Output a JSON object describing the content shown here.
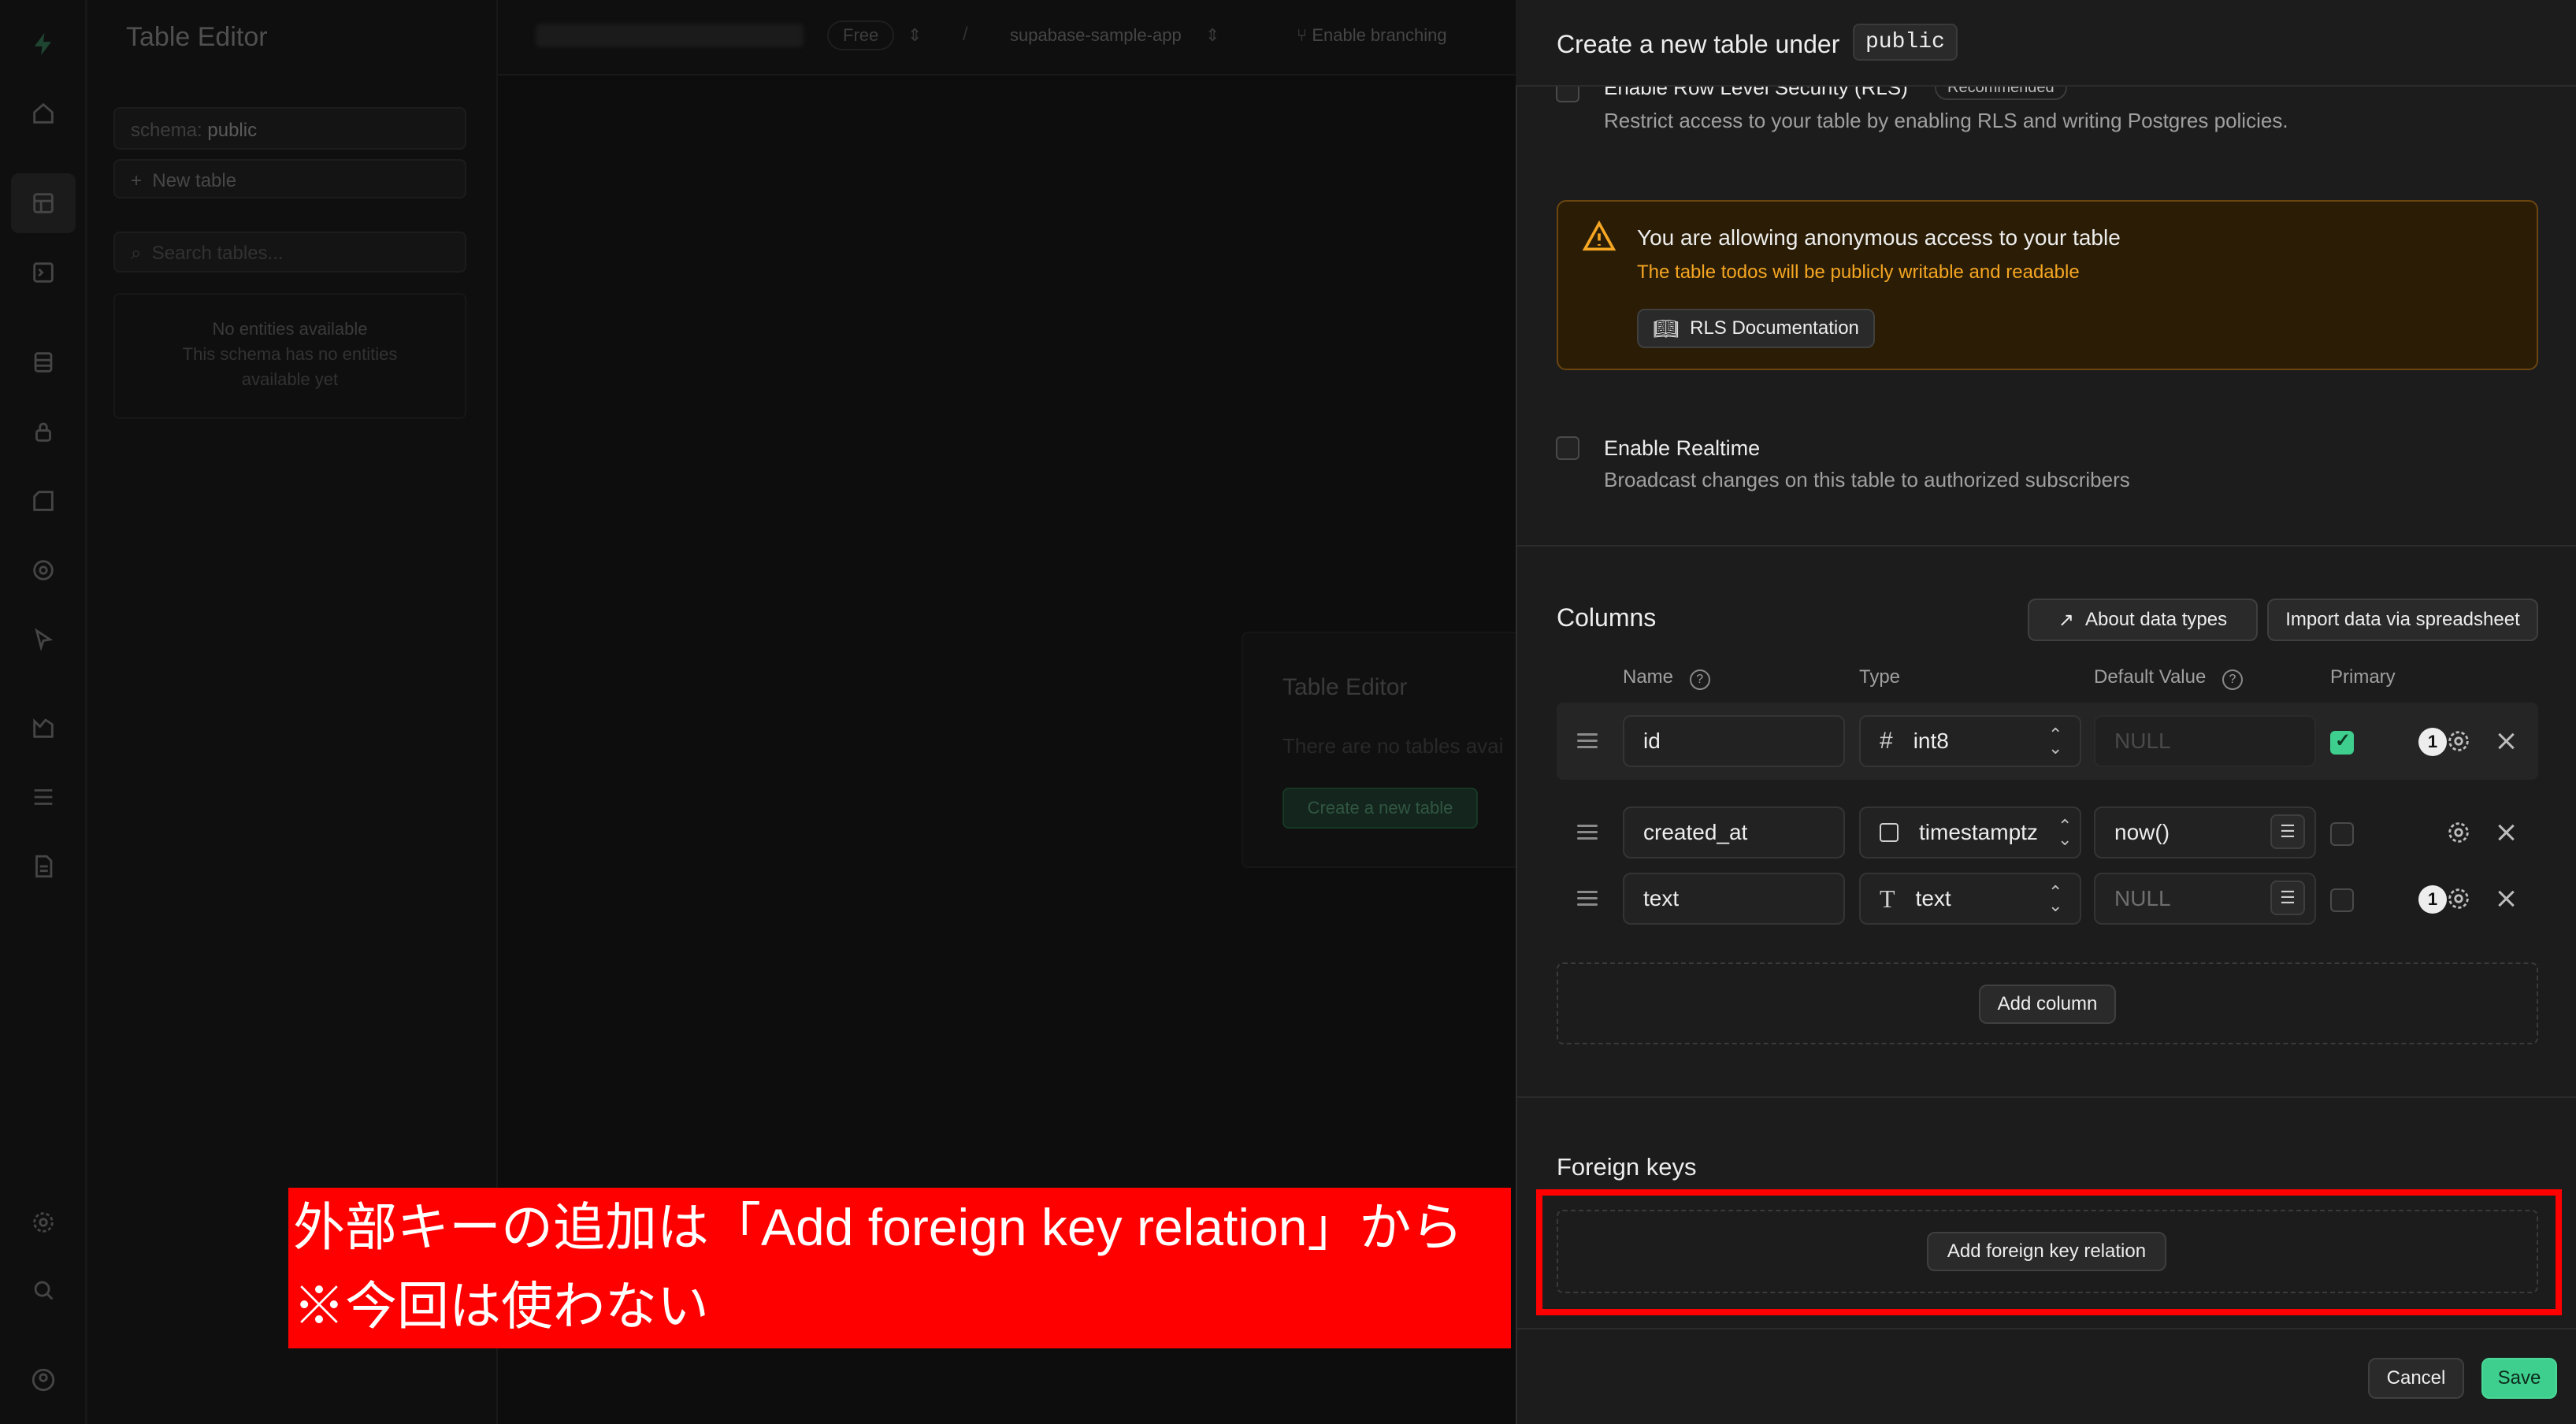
{
  "sidebar_nav": {
    "title": "Table Editor",
    "schema_label": "schema:",
    "schema_value": "public",
    "new_table": "New table",
    "search_placeholder": "Search tables...",
    "empty_title": "No entities available",
    "empty_desc_1": "This schema has no entities",
    "empty_desc_2": "available yet"
  },
  "topbar": {
    "plan_badge": "Free",
    "project": "supabase-sample-app",
    "branching": "Enable branching"
  },
  "empty_state": {
    "title": "Table Editor",
    "desc": "There are no tables avai",
    "button": "Create a new table"
  },
  "panel": {
    "header_text": "Create a new table under",
    "header_schema": "public",
    "rls_title": "Enable Row Level Security (RLS)",
    "rls_badge": "Recommended",
    "rls_desc": "Restrict access to your table by enabling RLS and writing Postgres policies.",
    "warning_title": "You are allowing anonymous access to your table",
    "warning_desc": "The table todos will be publicly writable and readable",
    "rls_doc_button": "RLS Documentation",
    "realtime_title": "Enable Realtime",
    "realtime_desc": "Broadcast changes on this table to authorized subscribers",
    "columns_title": "Columns",
    "about_types_button": "About data types",
    "import_button": "Import data via spreadsheet",
    "col_headers": {
      "name": "Name",
      "type": "Type",
      "default": "Default Value",
      "primary": "Primary"
    },
    "columns": [
      {
        "name": "id",
        "type_icon": "hash-icon",
        "type": "int8",
        "default": "NULL",
        "primary": true,
        "badge": "1"
      },
      {
        "name": "created_at",
        "type_icon": "calendar-icon",
        "type": "timestamptz",
        "default": "now()",
        "primary": false,
        "badge": ""
      },
      {
        "name": "text",
        "type_icon": "text-type-icon",
        "type": "text",
        "default": "NULL",
        "primary": false,
        "badge": "1"
      }
    ],
    "add_column_button": "Add column",
    "foreign_keys_title": "Foreign keys",
    "add_fk_button": "Add foreign key relation",
    "cancel_button": "Cancel",
    "save_button": "Save"
  },
  "annotation": {
    "line1": "外部キーの追加は「Add foreign key relation」から",
    "line2": "※今回は使わない"
  },
  "colors": {
    "accent_green": "#3ecf8e",
    "warning_orange": "#f5a623",
    "annotation_red": "#ff0000"
  }
}
